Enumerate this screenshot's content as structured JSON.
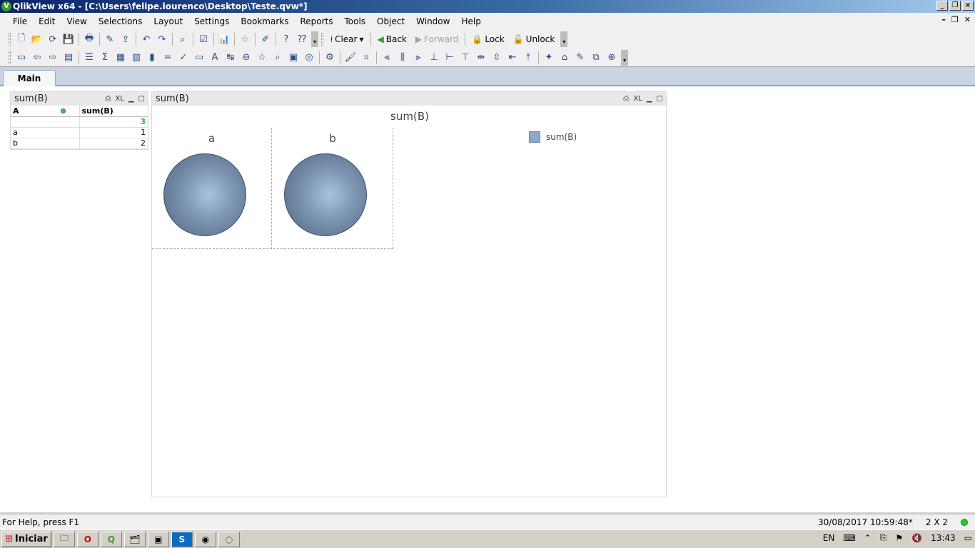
{
  "window": {
    "title": "QlikView x64 - [C:\\Users\\felipe.lourenco\\Desktop\\Teste.qvw*]",
    "app_icon": "V"
  },
  "menu": [
    "File",
    "Edit",
    "View",
    "Selections",
    "Layout",
    "Settings",
    "Bookmarks",
    "Reports",
    "Tools",
    "Object",
    "Window",
    "Help"
  ],
  "toolbar": {
    "clear": "Clear",
    "back": "Back",
    "forward": "Forward",
    "lock": "Lock",
    "unlock": "Unlock"
  },
  "tabs": [
    {
      "label": "Main"
    }
  ],
  "table_box": {
    "caption": "sum(B)",
    "caption_icons": [
      "print-icon",
      "excel-icon",
      "minimize-icon",
      "maximize-icon"
    ],
    "headers": [
      "A",
      "sum(B)"
    ],
    "total": "3",
    "rows": [
      {
        "a": "a",
        "v": "1"
      },
      {
        "a": "b",
        "v": "2"
      }
    ]
  },
  "chart_box": {
    "caption": "sum(B)",
    "xl": "XL"
  },
  "chart_data": {
    "type": "pie",
    "title": "sum(B)",
    "trellis_by": "A",
    "categories": [
      "a",
      "b"
    ],
    "series": [
      {
        "name": "sum(B)",
        "values": [
          1,
          2
        ]
      }
    ],
    "legend": "top-right",
    "colors": [
      "#8ea9c8"
    ]
  },
  "status": {
    "help": "For Help, press F1",
    "timestamp": "30/08/2017 10:59:48*",
    "grid": "2 X 2"
  },
  "taskbar": {
    "start": "Iniciar",
    "lang": "EN",
    "clock": "13:43"
  }
}
